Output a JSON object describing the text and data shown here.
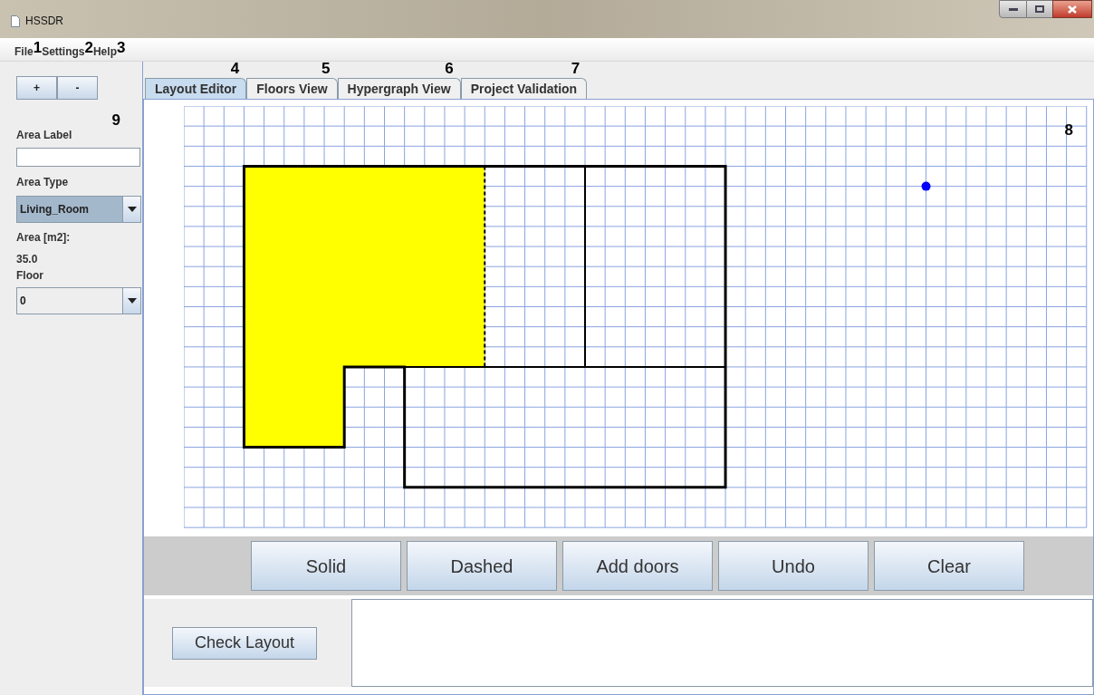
{
  "window": {
    "title": "HSSDR"
  },
  "menu": [
    {
      "label": "File",
      "marker": "1"
    },
    {
      "label": "Settings",
      "marker": "2"
    },
    {
      "label": "Help",
      "marker": "3"
    }
  ],
  "zoom_buttons": [
    "+",
    "-"
  ],
  "side_panel": {
    "marker": "9",
    "area_label": {
      "label": "Area Label"
    },
    "area_type": {
      "label": "Area Type",
      "value": "Living_Room"
    },
    "area": {
      "label": "Area [m2]:",
      "value": "35.0"
    },
    "floor": {
      "label": "Floor",
      "value": "0"
    }
  },
  "tabs": [
    {
      "label": "Layout Editor",
      "selected": true,
      "marker": "4"
    },
    {
      "label": "Floors View",
      "selected": false,
      "marker": "5"
    },
    {
      "label": "Hypergraph View",
      "selected": false,
      "marker": "6"
    },
    {
      "label": "Project Validation",
      "selected": false,
      "marker": "7"
    }
  ],
  "canvas": {
    "marker": "8"
  },
  "tools": [
    "Solid",
    "Dashed",
    "Add doors",
    "Undo",
    "Clear"
  ],
  "check_button": "Check Layout"
}
